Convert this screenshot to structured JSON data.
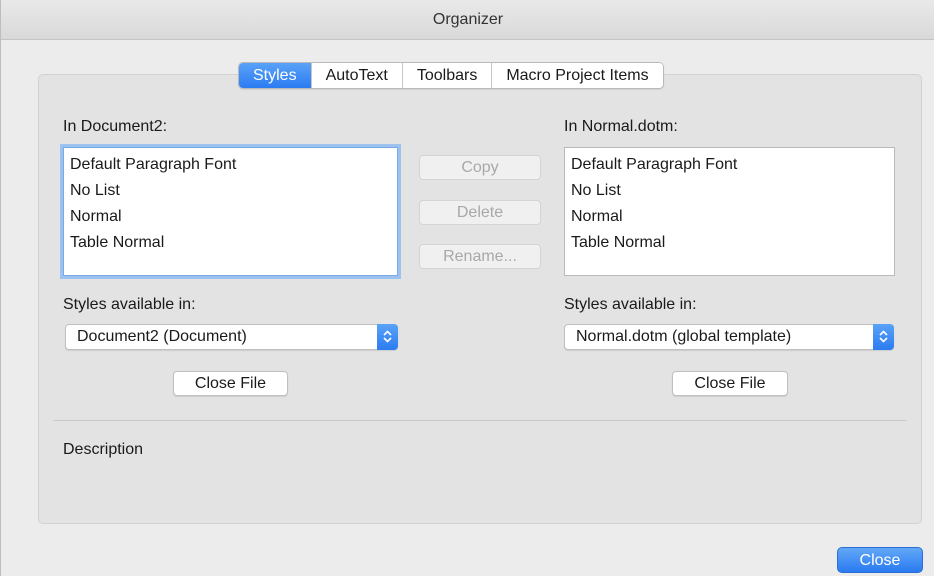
{
  "window": {
    "title": "Organizer"
  },
  "tabs": [
    {
      "label": "Styles",
      "active": true
    },
    {
      "label": "AutoText",
      "active": false
    },
    {
      "label": "Toolbars",
      "active": false
    },
    {
      "label": "Macro Project Items",
      "active": false
    }
  ],
  "left": {
    "heading": "In Document2:",
    "items": [
      "Default Paragraph Font",
      "No List",
      "Normal",
      "Table Normal"
    ],
    "available_label": "Styles available in:",
    "available_value": "Document2 (Document)",
    "close_file": "Close File"
  },
  "right": {
    "heading": "In Normal.dotm:",
    "items": [
      "Default Paragraph Font",
      "No List",
      "Normal",
      "Table Normal"
    ],
    "available_label": "Styles available in:",
    "available_value": "Normal.dotm (global template)",
    "close_file": "Close File"
  },
  "actions": {
    "copy": "Copy",
    "delete": "Delete",
    "rename": "Rename..."
  },
  "description_label": "Description",
  "close_button": "Close",
  "colors": {
    "accent": "#2b7cf2",
    "pane": "#e3e3e3",
    "window": "#ececec"
  }
}
